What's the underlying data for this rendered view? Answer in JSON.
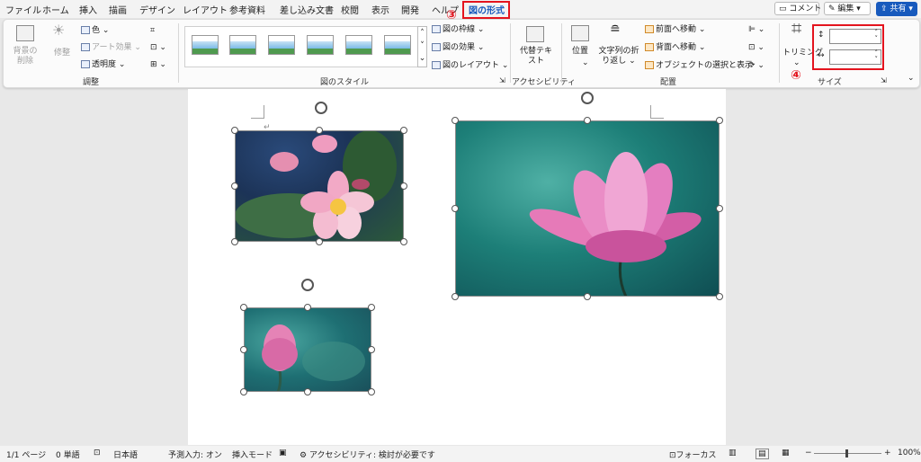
{
  "tabs": [
    "ファイル",
    "ホーム",
    "挿入",
    "描画",
    "デザイン",
    "レイアウト",
    "参考資料",
    "差し込み文書",
    "校閲",
    "表示",
    "開発",
    "ヘルプ",
    "図の形式"
  ],
  "active_tab": "図の形式",
  "annotations": {
    "step3": "③",
    "step4": "④"
  },
  "top_buttons": {
    "comment": "コメント",
    "edit": "編集",
    "share": "共有"
  },
  "ribbon": {
    "adjust": {
      "remove_bg": "背景の削除",
      "corrections": "修整",
      "color": "色",
      "artistic": "アート効果",
      "transparency": "透明度",
      "group": "調整"
    },
    "styles": {
      "border": "図の枠線",
      "effects": "図の効果",
      "layout": "図のレイアウト",
      "group": "図のスタイル"
    },
    "accessibility": {
      "alt_text": "代替テキスト",
      "group": "アクセシビリティ"
    },
    "arrange": {
      "position": "位置",
      "wrap": "文字列の折り返し",
      "bring_forward": "前面へ移動",
      "send_backward": "背面へ移動",
      "selection_pane": "オブジェクトの選択と表示",
      "group": "配置"
    },
    "size": {
      "crop": "トリミング",
      "height_value": "",
      "width_value": "",
      "group": "サイズ"
    }
  },
  "status": {
    "page": "1/1 ページ",
    "words": "0 単語",
    "language": "日本語",
    "predict": "予測入力: オン",
    "insert_mode": "挿入モード",
    "accessibility": "アクセシビリティ: 検討が必要です",
    "focus": "フォーカス",
    "zoom": "100%"
  },
  "colors": {
    "accent": "#185abd",
    "highlight": "#e4141e"
  }
}
